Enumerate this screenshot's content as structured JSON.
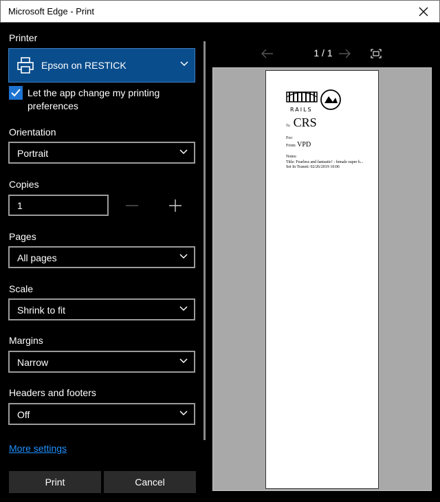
{
  "window": {
    "title": "Microsoft Edge - Print"
  },
  "printer": {
    "label": "Printer",
    "value": "Epson on RESTICK"
  },
  "app_prefs": {
    "checked": true,
    "label": "Let the app change my printing preferences"
  },
  "orientation": {
    "label": "Orientation",
    "value": "Portrait"
  },
  "copies": {
    "label": "Copies",
    "value": "1"
  },
  "pages": {
    "label": "Pages",
    "value": "All pages"
  },
  "scale": {
    "label": "Scale",
    "value": "Shrink to fit"
  },
  "margins": {
    "label": "Margins",
    "value": "Narrow"
  },
  "headers_footers": {
    "label": "Headers and footers",
    "value": "Off"
  },
  "more_settings": "More settings",
  "buttons": {
    "print": "Print",
    "cancel": "Cancel"
  },
  "preview": {
    "page_indicator": "1  /  1",
    "doc": {
      "logo_text": "RAILS",
      "to_label": "To:",
      "to_value": "CRS",
      "for_label": "For:",
      "from_label": "From:",
      "from_value": "VPD",
      "notes_label": "Notes:",
      "title_line": "Title: Fearless and fantastic! : female super h...",
      "transit_line": "Set In Transit: 02/26/2019 10:06"
    }
  },
  "colors": {
    "accent": "#1e73d1",
    "printer_bg": "#0a4d8c",
    "link": "#1e90ff"
  }
}
